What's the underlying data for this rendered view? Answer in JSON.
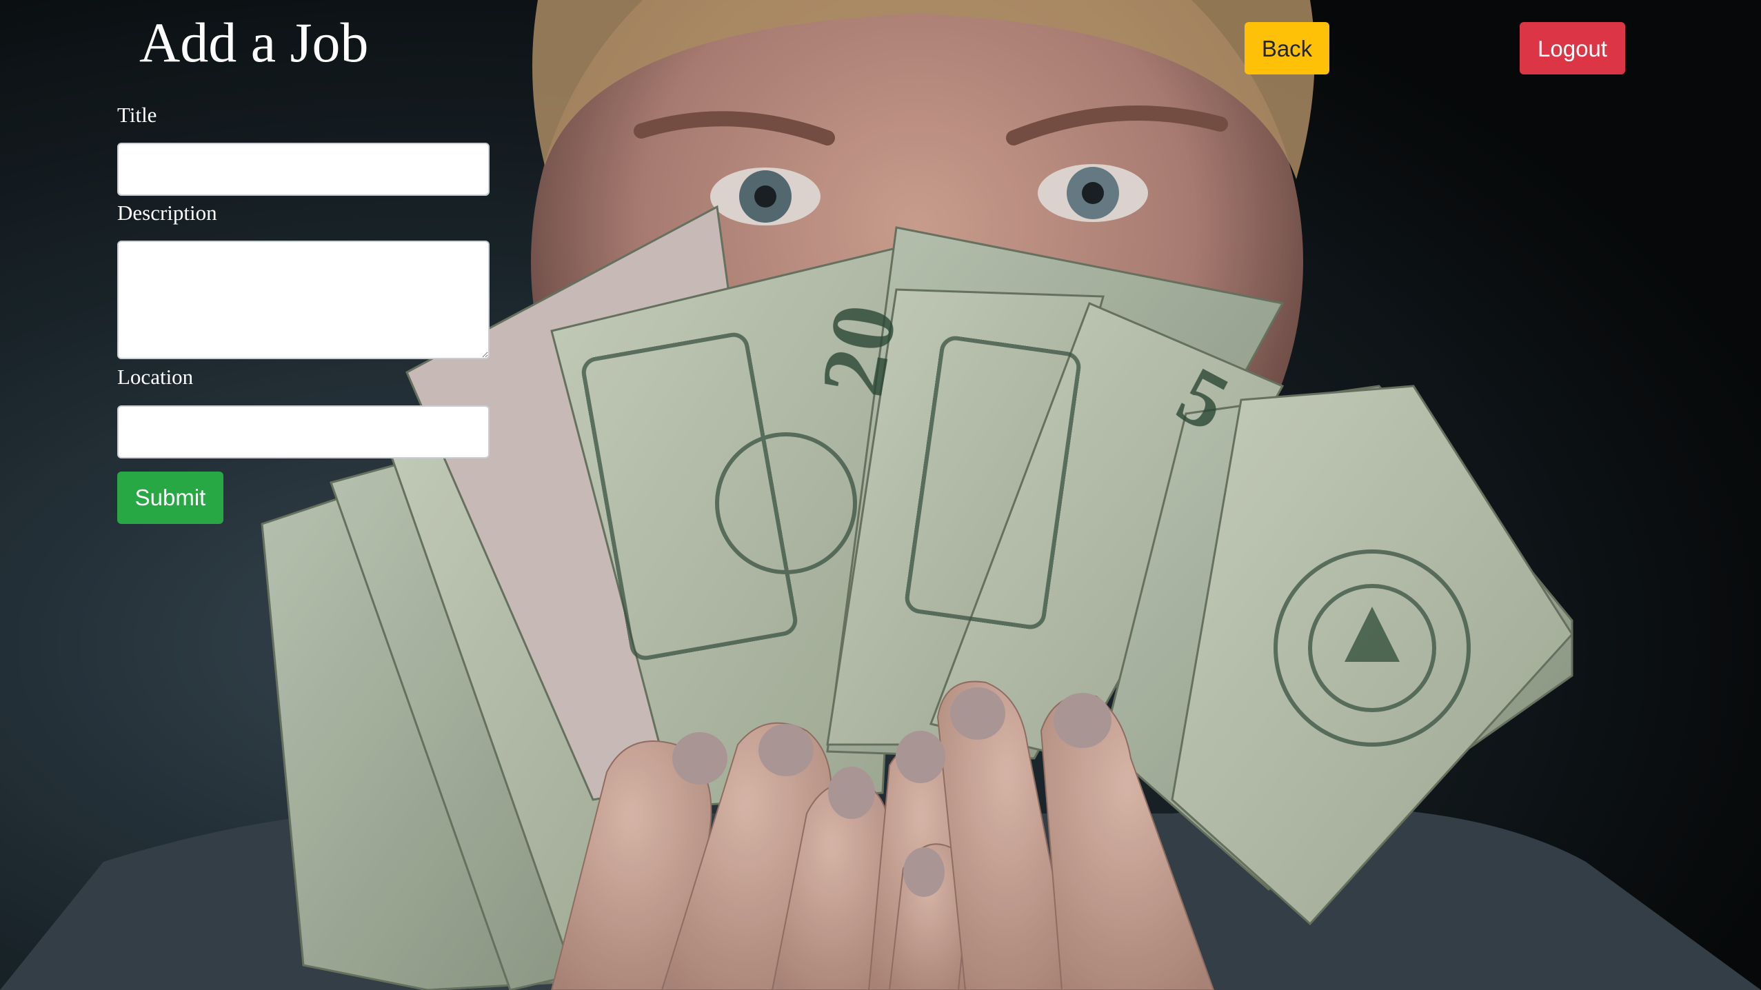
{
  "page": {
    "title": "Add a Job"
  },
  "header": {
    "back_label": "Back",
    "logout_label": "Logout"
  },
  "form": {
    "title_label": "Title",
    "title_value": "",
    "description_label": "Description",
    "description_value": "",
    "location_label": "Location",
    "location_value": "",
    "submit_label": "Submit"
  },
  "colors": {
    "back_button": "#ffc107",
    "logout_button": "#dc3545",
    "submit_button": "#28a745"
  }
}
